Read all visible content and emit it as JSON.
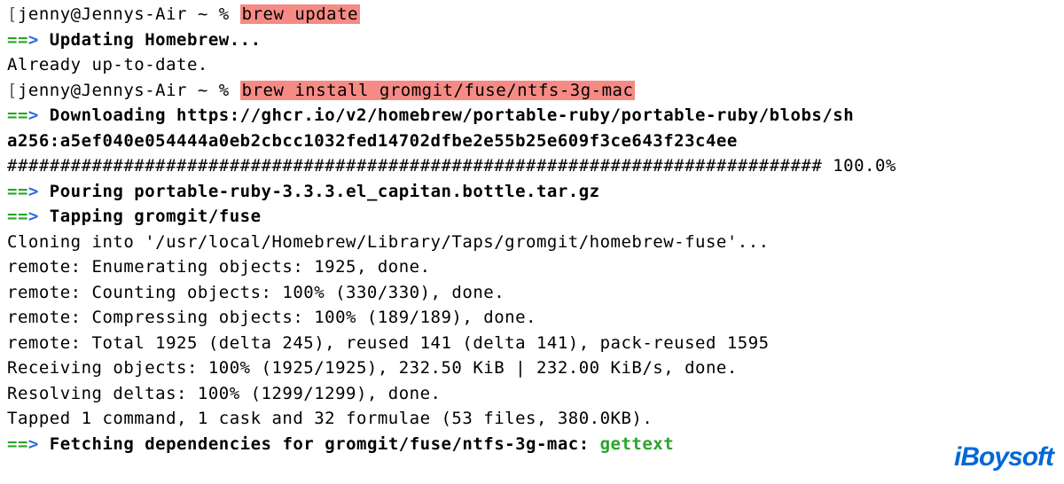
{
  "prompt1": {
    "bracket_left": "[",
    "user_host": "jenny@Jennys-Air ~ % ",
    "command": "brew update",
    "bracket_right": "]"
  },
  "line2": {
    "arrow": "==",
    "arrow_tip": "> ",
    "text": "Updating Homebrew..."
  },
  "line3": "Already up-to-date.",
  "prompt2": {
    "bracket_left": "[",
    "user_host": "jenny@Jennys-Air ~ % ",
    "command": "brew install gromgit/fuse/ntfs-3g-mac",
    "bracket_right": "]"
  },
  "line5": {
    "arrow": "==",
    "arrow_tip": "> ",
    "text": "Downloading https://ghcr.io/v2/homebrew/portable-ruby/portable-ruby/blobs/sh"
  },
  "line6": "a256:a5ef040e054444a0eb2cbcc1032fed14702dfbe2e55b25e609f3ce643f23c4ee",
  "line7": "############################################################################# 100.0%",
  "line8": {
    "arrow": "==",
    "arrow_tip": "> ",
    "text": "Pouring portable-ruby-3.3.3.el_capitan.bottle.tar.gz"
  },
  "line9": {
    "arrow": "==",
    "arrow_tip": "> ",
    "text": "Tapping gromgit/fuse"
  },
  "line10": "Cloning into '/usr/local/Homebrew/Library/Taps/gromgit/homebrew-fuse'...",
  "line11": "remote: Enumerating objects: 1925, done.",
  "line12": "remote: Counting objects: 100% (330/330), done.",
  "line13": "remote: Compressing objects: 100% (189/189), done.",
  "line14": "remote: Total 1925 (delta 245), reused 141 (delta 141), pack-reused 1595",
  "line15": "Receiving objects: 100% (1925/1925), 232.50 KiB | 232.00 KiB/s, done.",
  "line16": "Resolving deltas: 100% (1299/1299), done.",
  "line17": "Tapped 1 command, 1 cask and 32 formulae (53 files, 380.0KB).",
  "line18": {
    "arrow": "==",
    "arrow_tip": "> ",
    "text": "Fetching dependencies for gromgit/fuse/ntfs-3g-mac: ",
    "dep": "gettext"
  },
  "watermark": {
    "i": "i",
    "b": "B",
    "rest": "oysoft"
  }
}
